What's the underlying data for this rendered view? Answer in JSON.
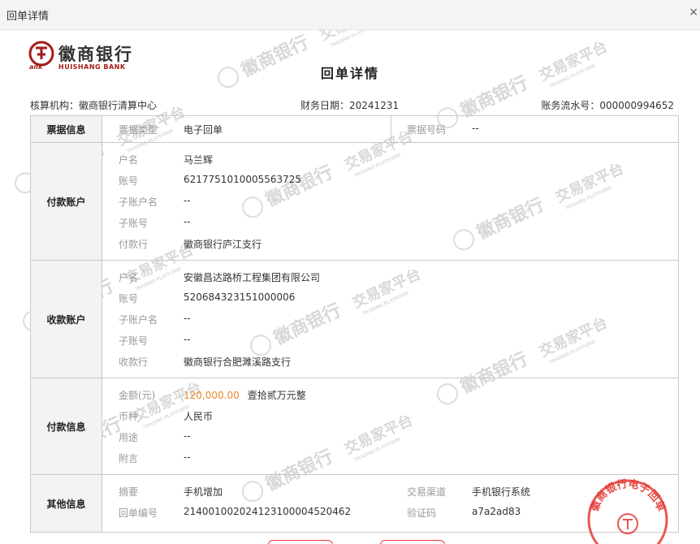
{
  "window": {
    "title": "回单详情",
    "close_glyph": "×"
  },
  "logo": {
    "cn": "徽商银行",
    "en": "HUISHANG BANK",
    "prefix": "ank"
  },
  "doc_title": "回单详情",
  "meta": {
    "org_label": "核算机构：",
    "org_value": "徽商银行清算中心",
    "date_label": "财务日期：",
    "date_value": "20241231",
    "serial_label": "账务流水号：",
    "serial_value": "000000994652"
  },
  "ticket": {
    "section": "票据信息",
    "type_label": "票据类型",
    "type_value": "电子回单",
    "no_label": "票据号码",
    "no_value": "--"
  },
  "payer": {
    "section": "付款账户",
    "rows": [
      {
        "label": "户名",
        "value": "马兰辉"
      },
      {
        "label": "账号",
        "value": "6217751010005563725"
      },
      {
        "label": "子账户名",
        "value": "--"
      },
      {
        "label": "子账号",
        "value": "--"
      },
      {
        "label": "付款行",
        "value": "徽商银行庐江支行"
      }
    ]
  },
  "payee": {
    "section": "收款账户",
    "rows": [
      {
        "label": "户名",
        "value": "安徽昌达路桥工程集团有限公司"
      },
      {
        "label": "账号",
        "value": "520684323151000006"
      },
      {
        "label": "子账户名",
        "value": "--"
      },
      {
        "label": "子账号",
        "value": "--"
      },
      {
        "label": "收款行",
        "value": "徽商银行合肥濉溪路支行"
      }
    ]
  },
  "payment": {
    "section": "付款信息",
    "amount_label": "金额(元)",
    "amount_value": "120,000.00",
    "amount_words": "壹拾贰万元整",
    "currency_label": "币种",
    "currency_value": "人民币",
    "purpose_label": "用途",
    "purpose_value": "--",
    "note_label": "附言",
    "note_value": "--"
  },
  "other": {
    "section": "其他信息",
    "summary_label": "摘要",
    "summary_value": "手机增加",
    "channel_label": "交易渠道",
    "channel_value": "手机银行系统",
    "receipt_label": "回单编号",
    "receipt_value": "21400100202412310000452046​2",
    "verify_label": "验证码",
    "verify_value": "a7a2ad83"
  },
  "watermark": {
    "cn": "徽商银行",
    "platform_cn": "交易家平台",
    "platform_en": "TRADING PLATFORM"
  },
  "stamp": {
    "text": "徽商银行电子回单"
  },
  "colors": {
    "brand_red": "#a51b1b",
    "amount_orange": "#e88a2e",
    "stamp_red": "#e53935"
  }
}
